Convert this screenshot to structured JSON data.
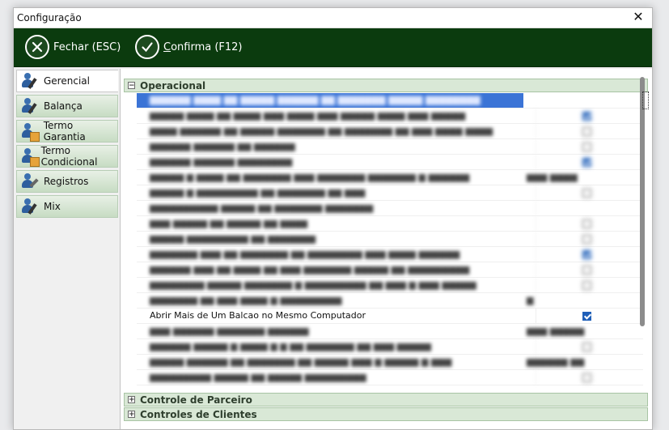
{
  "window": {
    "title": "Configuração",
    "close_glyph": "✕"
  },
  "toolbar": {
    "fechar_label": "Fechar (ESC)",
    "confirma_label_prefix": "C",
    "confirma_label_rest": "onfirma (F12)",
    "fechar_icon": "x-circle-icon",
    "confirma_icon": "check-circle-icon"
  },
  "nav": {
    "items": [
      {
        "label": "Gerencial",
        "icon": "user-edit-icon",
        "active": true
      },
      {
        "label": "Balança",
        "icon": "user-edit-icon",
        "active": false
      },
      {
        "label": "Termo Garantia",
        "icon": "user-box-icon",
        "active": false
      },
      {
        "label": "Termo Condicional",
        "icon": "user-box-icon",
        "active": false
      },
      {
        "label": "Registros",
        "icon": "user-wrench-icon",
        "active": false
      },
      {
        "label": "Mix",
        "icon": "user-edit-icon",
        "active": false
      }
    ]
  },
  "groups": {
    "operacional": {
      "label": "Operacional",
      "expander": "−"
    },
    "controle_parceiro": {
      "label": "Controle de Parceiro",
      "expander": "+"
    },
    "controles_clientes": {
      "label": "Controles de Clientes",
      "expander": "+"
    }
  },
  "rows": {
    "visible": {
      "label": "Abrir Mais de Um Balcao no Mesmo Computador",
      "checked": true
    }
  },
  "colors": {
    "toolbar_bg": "#0b3b0e",
    "group_header_bg": "#d9e8d6",
    "selection": "#3b74d6"
  }
}
